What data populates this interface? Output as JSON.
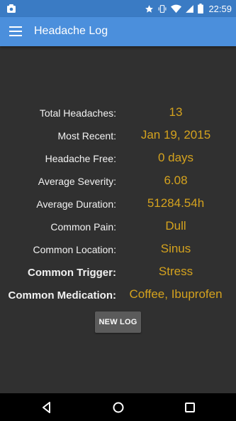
{
  "status_bar": {
    "time": "22:59",
    "icons": [
      "notification-icon",
      "star-icon",
      "vibrate-icon",
      "wifi-icon",
      "cellular-icon",
      "battery-icon"
    ]
  },
  "app_bar": {
    "title": "Headache Log",
    "menu_icon": "hamburger-menu-icon"
  },
  "stats": [
    {
      "label": "Total Headaches:",
      "value": "13",
      "bold": false
    },
    {
      "label": "Most Recent:",
      "value": "Jan 19, 2015",
      "bold": false
    },
    {
      "label": "Headache Free:",
      "value": "0 days",
      "bold": false
    },
    {
      "label": "Average Severity:",
      "value": "6.08",
      "bold": false
    },
    {
      "label": "Average Duration:",
      "value": "51284.54h",
      "bold": false
    },
    {
      "label": "Common Pain:",
      "value": "Dull",
      "bold": false
    },
    {
      "label": "Common Location:",
      "value": "Sinus",
      "bold": false
    },
    {
      "label": "Common Trigger:",
      "value": "Stress",
      "bold": true
    },
    {
      "label": "Common Medication:",
      "value": "Coffee, Ibuprofen",
      "bold": true
    }
  ],
  "new_log_button": "NEW LOG",
  "nav_bar": {
    "icons": [
      "back-icon",
      "home-icon",
      "recents-icon"
    ]
  },
  "colors": {
    "status_bar": "#3a7bc4",
    "app_bar": "#4b8fdc",
    "background": "#303030",
    "value_text": "#d4a21e",
    "label_text": "#f2f2f2",
    "button": "#5b5b5b"
  }
}
